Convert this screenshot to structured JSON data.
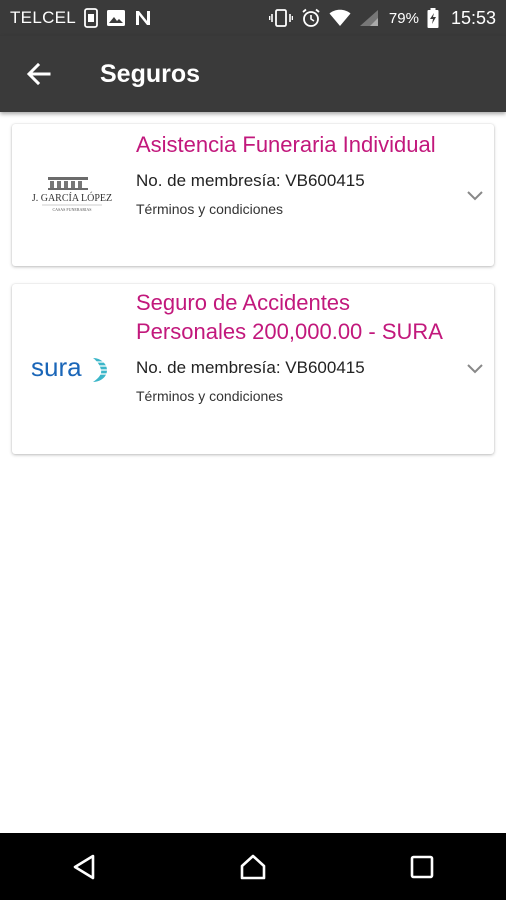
{
  "status_bar": {
    "carrier": "TELCEL",
    "battery_percent": "79%",
    "time": "15:53",
    "icons": [
      "sim-icon",
      "image-icon",
      "n-icon",
      "vibrate-icon",
      "alarm-icon",
      "wifi-icon",
      "signal-icon",
      "battery-charging-icon"
    ]
  },
  "app_bar": {
    "title": "Seguros",
    "back_icon": "arrow-back-icon"
  },
  "policies": [
    {
      "logo_name": "J. GARCÍA LÓPEZ",
      "logo_subtitle": "CASAS FUNERARIAS",
      "title": "Asistencia Funeraria Individual",
      "membership": "No. de membresía: VB600415",
      "terms": "Términos y condiciones"
    },
    {
      "logo_name": "sura",
      "title": "Seguro de Accidentes Personales 200,000.00 - SURA",
      "membership": "No. de membresía: VB600415",
      "terms": "Términos y condiciones"
    }
  ],
  "colors": {
    "accent": "#c2187c",
    "bar": "#3a3a3a",
    "sura_blue": "#1a66b8",
    "sura_teal": "#3bb6c9"
  },
  "nav_bar": {
    "icons": [
      "back-triangle-icon",
      "home-icon",
      "recents-icon"
    ]
  }
}
